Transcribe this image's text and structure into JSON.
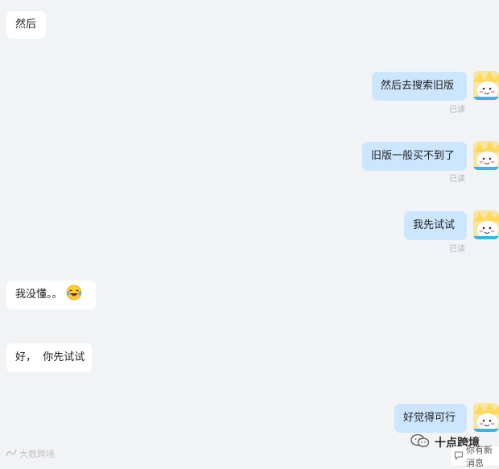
{
  "messages": [
    {
      "text": "然后"
    },
    {
      "text": "然后去搜索旧版",
      "status": "已读"
    },
    {
      "text": "旧版一般买不到了",
      "status": "已读"
    },
    {
      "text": "我先试试",
      "status": "已读"
    },
    {
      "text": "我没懂。。",
      "emoji": "laughing-tears-emoji"
    },
    {
      "text": "好，  你先试试"
    },
    {
      "text": "好觉得可行"
    }
  ],
  "watermark": "大数跨境",
  "brand": "十点跨境",
  "new_message_hint": "你有新消息",
  "colors": {
    "background": "#f2f3f5",
    "incoming_bubble": "#ffffff",
    "outgoing_bubble": "#cde6ff",
    "read_status": "#b0b3b8"
  }
}
